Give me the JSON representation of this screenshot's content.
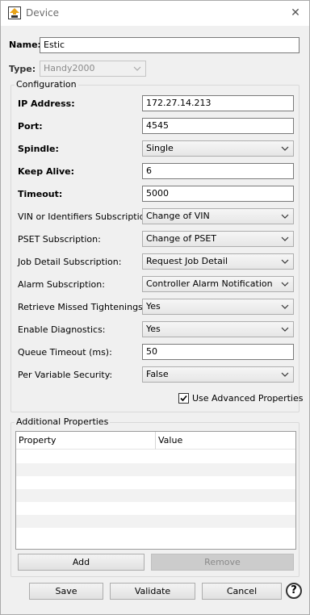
{
  "window": {
    "title": "Device"
  },
  "name": {
    "label": "Name:",
    "value": "Estic"
  },
  "type": {
    "label": "Type:",
    "value": "Handy2000"
  },
  "configuration": {
    "title": "Configuration",
    "ip_address": {
      "label": "IP Address:",
      "value": "172.27.14.213"
    },
    "port": {
      "label": "Port:",
      "value": "4545"
    },
    "spindle": {
      "label": "Spindle:",
      "value": "Single"
    },
    "keep_alive": {
      "label": "Keep Alive:",
      "value": "6"
    },
    "timeout": {
      "label": "Timeout:",
      "value": "5000"
    },
    "vin_subscription": {
      "label": "VIN or Identifiers Subscription:",
      "value": "Change of VIN"
    },
    "pset_subscription": {
      "label": "PSET Subscription:",
      "value": "Change of PSET"
    },
    "job_detail_subscription": {
      "label": "Job Detail Subscription:",
      "value": "Request Job Detail"
    },
    "alarm_subscription": {
      "label": "Alarm Subscription:",
      "value": "Controller Alarm Notification"
    },
    "retrieve_missed": {
      "label": "Retrieve Missed Tightenings:",
      "value": "Yes"
    },
    "enable_diagnostics": {
      "label": "Enable Diagnostics:",
      "value": "Yes"
    },
    "queue_timeout": {
      "label": "Queue Timeout (ms):",
      "value": "50"
    },
    "per_variable_security": {
      "label": "Per Variable Security:",
      "value": "False"
    },
    "advanced": {
      "label": "Use Advanced Properties",
      "checked": true
    }
  },
  "additional": {
    "title": "Additional Properties",
    "columns": [
      "Property",
      "Value"
    ],
    "rows": [],
    "add_label": "Add",
    "remove_label": "Remove"
  },
  "footer": {
    "save_label": "Save",
    "validate_label": "Validate",
    "cancel_label": "Cancel",
    "help_glyph": "?"
  }
}
